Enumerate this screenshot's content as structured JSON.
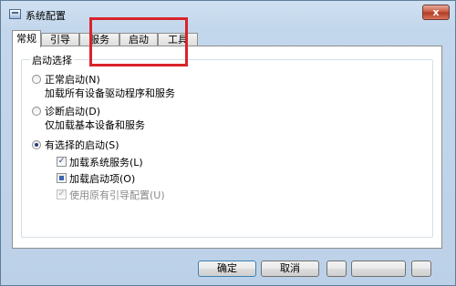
{
  "window": {
    "title": "系统配置",
    "close_glyph": "x"
  },
  "tabs": [
    {
      "label": "常规",
      "active": true
    },
    {
      "label": "引导",
      "active": false
    },
    {
      "label": "服务",
      "active": false
    },
    {
      "label": "启动",
      "active": false
    },
    {
      "label": "工具",
      "active": false
    }
  ],
  "startup_selection": {
    "group_label": "启动选择",
    "options": [
      {
        "label": "正常启动(N)",
        "description": "加载所有设备驱动程序和服务",
        "selected": false
      },
      {
        "label": "诊断启动(D)",
        "description": "仅加载基本设备和服务",
        "selected": false
      },
      {
        "label": "有选择的启动(S)",
        "selected": true
      }
    ],
    "selective": {
      "load_system_services": {
        "label": "加载系统服务(L)",
        "checked": true
      },
      "load_startup_items": {
        "label": "加载启动项(O)",
        "state": "partial"
      },
      "use_original_boot_config": {
        "label": "使用原有引导配置(U)",
        "checked": true,
        "disabled": true
      }
    }
  },
  "buttons": {
    "ok": "确定",
    "cancel": "取消"
  },
  "annotation": {
    "color": "#d9232a"
  }
}
